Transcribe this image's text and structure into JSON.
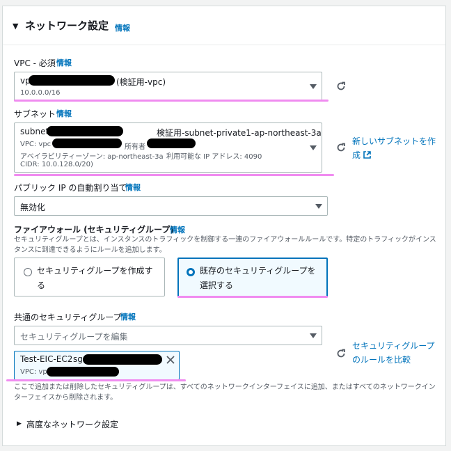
{
  "header": {
    "caret": "▼",
    "title": "ネットワーク設定",
    "info": "情報"
  },
  "vpc": {
    "label": "VPC - 必須",
    "info": "情報",
    "value_prefix": "vp",
    "value_suffix": "(検証用-vpc)",
    "cidr": "10.0.0.0/16"
  },
  "subnet": {
    "label": "サブネット",
    "info": "情報",
    "value_prefix": "subnet-",
    "value_name": "検証用-subnet-private1-ap-northeast-3a",
    "vpc_prefix": "VPC: vpc",
    "owner_label": "所有者",
    "az_line": "アベイラビリティーゾーン: ap-northeast-3a",
    "ip_line": "利用可能な IP アドレス: 4090",
    "cidr": "CIDR: 10.0.128.0/20)",
    "new_link": "新しいサブネットを作成"
  },
  "public_ip": {
    "label": "パブリック IP の自動割り当て",
    "info": "情報",
    "value": "無効化"
  },
  "firewall": {
    "label": "ファイアウォール (セキュリティグループ)",
    "info": "情報",
    "description": "セキュリティグループとは、インスタンスのトラフィックを制御する一連のファイアウォールルールです。特定のトラフィックがインスタンスに到達できるようにルールを追加します。",
    "option_create": "セキュリティグループを作成する",
    "option_existing": "既存のセキュリティグループを選択する"
  },
  "common_sg": {
    "label": "共通のセキュリティグループ",
    "info": "情報",
    "placeholder": "セキュリティグループを編集",
    "compare_link": "セキュリティグループのルールを比較",
    "chip_name": "Test-EIC-EC2",
    "chip_sg": "sg",
    "chip_vpc": "VPC: vpc",
    "note": "ここで追加または削除したセキュリティグループは、すべてのネットワークインターフェイスに追加、またはすべてのネットワークインターフェイスから削除されます。"
  },
  "advanced": {
    "caret": "▶",
    "label": "高度なネットワーク設定"
  },
  "colors": {
    "accent": "#0073bb",
    "highlight": "#f08cf0",
    "redaction": "#000000"
  }
}
